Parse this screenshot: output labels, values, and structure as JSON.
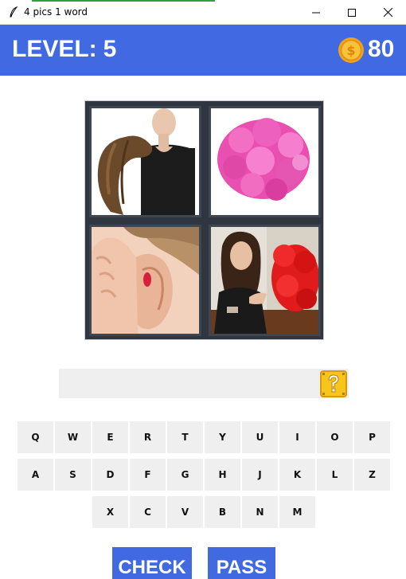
{
  "window": {
    "title": "4 pics 1 word",
    "icon": "feather-icon",
    "controls": [
      "minimize-icon",
      "maximize-icon",
      "close-icon"
    ]
  },
  "header": {
    "level_label": "LEVEL:",
    "level_value": "5",
    "coin_icon": "dollar-coin-icon",
    "coins": "80"
  },
  "pictures": [
    {
      "icon": "hair-wig-woman-image"
    },
    {
      "icon": "pink-curly-wig-image"
    },
    {
      "icon": "ear-listening-image"
    },
    {
      "icon": "woman-red-wig-image"
    }
  ],
  "answer": {
    "value": "",
    "hint_icon": "question-block-icon"
  },
  "keyboard": {
    "row1": [
      "Q",
      "W",
      "E",
      "R",
      "T",
      "Y",
      "U",
      "I",
      "O",
      "P"
    ],
    "row2": [
      "A",
      "S",
      "D",
      "F",
      "G",
      "H",
      "J",
      "K",
      "L",
      "Z"
    ],
    "row3": [
      "X",
      "C",
      "V",
      "B",
      "N",
      "M"
    ]
  },
  "buttons": {
    "check": "CHECK",
    "pass": "PASS"
  },
  "colors": {
    "header": "#4169e1",
    "key": "#efefef",
    "coin": "#f5a623",
    "hint": "#f7c51c"
  }
}
